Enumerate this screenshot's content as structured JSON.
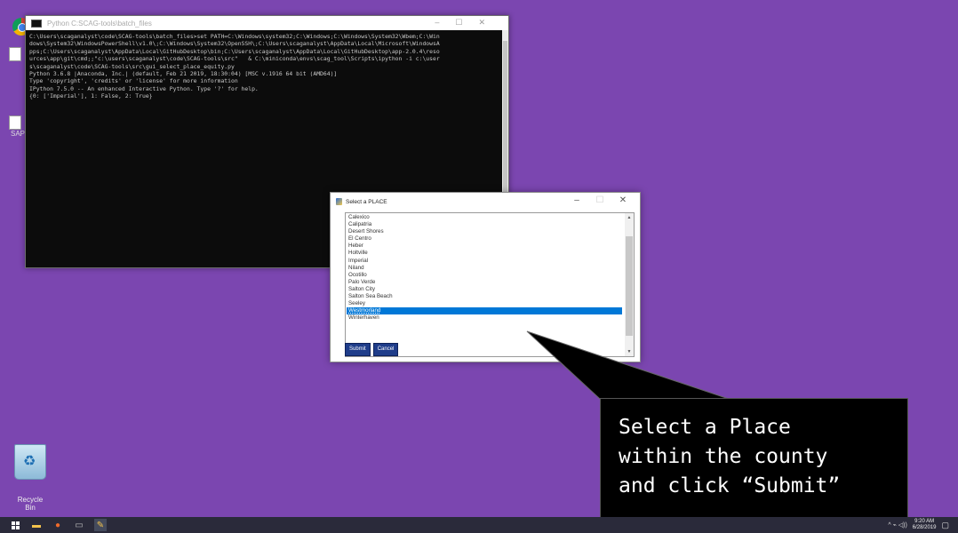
{
  "desktop": {
    "background_color": "#7b46b0",
    "icons": [
      {
        "name": "chrome-icon",
        "label": ""
      },
      {
        "name": "sap-icon",
        "label": "SAP"
      },
      {
        "name": "recycle-bin-icon",
        "label": "Recycle Bin"
      }
    ]
  },
  "terminal": {
    "title": "Python C:SCAG-tools\\batch_files",
    "controls": [
      "–",
      "☐",
      "✕"
    ],
    "lines": [
      "C:\\Users\\scaganalyst\\code\\SCAG-tools\\batch_files>set PATH=C:\\Windows\\system32;C:\\Windows;C:\\Windows\\System32\\Wbem;C:\\Win",
      "dows\\System32\\WindowsPowerShell\\v1.0\\;C:\\Windows\\System32\\OpenSSH\\;C:\\Users\\scaganalyst\\AppData\\Local\\Microsoft\\WindowsA",
      "pps;C:\\Users\\scaganalyst\\AppData\\Local\\GitHubDesktop\\bin;C:\\Users\\scaganalyst\\AppData\\Local\\GitHubDesktop\\app-2.0.4\\reso",
      "urces\\app\\git\\cmd;;\"c:\\users\\scaganalyst\\code\\SCAG-tools\\src\"   & C:\\miniconda\\envs\\scag_tool\\Scripts\\ipython -i c:\\user",
      "s\\scaganalyst\\code\\SCAG-tools\\src\\gui_select_place_equity.py",
      "Python 3.6.8 |Anaconda, Inc.| (default, Feb 21 2019, 18:30:04) [MSC v.1916 64 bit (AMD64)]",
      "Type 'copyright', 'credits' or 'license' for more information",
      "IPython 7.5.0 -- An enhanced Interactive Python. Type '?' for help.",
      "{0: ['Imperial'], 1: False, 2: True}"
    ]
  },
  "dialog": {
    "title": "Select a PLACE",
    "controls": [
      "–",
      "☐",
      "✕"
    ],
    "places": [
      "Calexico",
      "Calipatria",
      "Desert Shores",
      "El Centro",
      "Heber",
      "Holtville",
      "Imperial",
      "Niland",
      "Ocotillo",
      "Palo Verde",
      "Salton City",
      "Salton Sea Beach",
      "Seeley",
      "Westmorland",
      "Winterhaven"
    ],
    "selected": "Westmorland",
    "submit_label": "Submit",
    "cancel_label": "Cancel"
  },
  "callout": {
    "text": "Select a Place\nwithin the county\nand click “Submit”"
  },
  "taskbar": {
    "clock_time": "9:20 AM",
    "clock_date": "6/28/2019",
    "tray_glyphs": "^ ⌁ ◁))"
  }
}
